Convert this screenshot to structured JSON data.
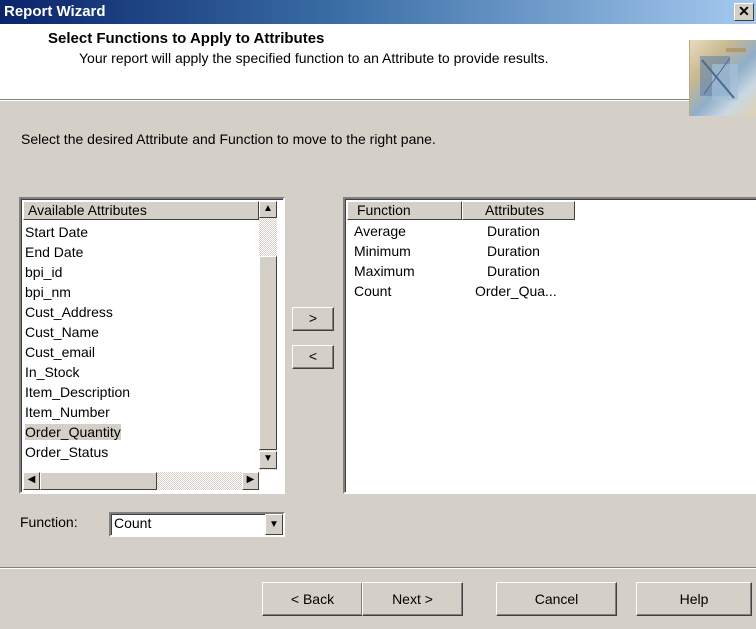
{
  "window": {
    "title": "Report Wizard",
    "close_glyph": "✕"
  },
  "header": {
    "title": "Select Functions to Apply to Attributes",
    "subtitle": "Your report will apply the specified function to an Attribute to provide results."
  },
  "instruction": "Select the desired Attribute and  Function to move to the right pane.",
  "left_list": {
    "header": "Available Attributes",
    "items": [
      "Start Date",
      "End Date",
      "bpi_id",
      "bpi_nm",
      "Cust_Address",
      "Cust_Name",
      "Cust_email",
      "In_Stock",
      "Item_Description",
      "Item_Number",
      "Order_Quantity",
      "Order_Status"
    ],
    "selected": "Order_Quantity"
  },
  "move_buttons": {
    "add": ">",
    "remove": "<"
  },
  "right_list": {
    "columns": [
      "Function",
      "Attributes"
    ],
    "rows": [
      {
        "function": "Average",
        "attribute": "Duration"
      },
      {
        "function": "Minimum",
        "attribute": "Duration"
      },
      {
        "function": "Maximum",
        "attribute": "Duration"
      },
      {
        "function": "Count",
        "attribute": "Order_Qua..."
      }
    ]
  },
  "function_field": {
    "label": "Function:",
    "value": "Count"
  },
  "footer_buttons": {
    "back": "< Back",
    "next": "Next >",
    "cancel": "Cancel",
    "help": "Help"
  },
  "icons": {
    "scroll_up": "▲",
    "scroll_down": "▼",
    "scroll_left": "◀",
    "scroll_right": "▶",
    "dropdown": "▼"
  }
}
